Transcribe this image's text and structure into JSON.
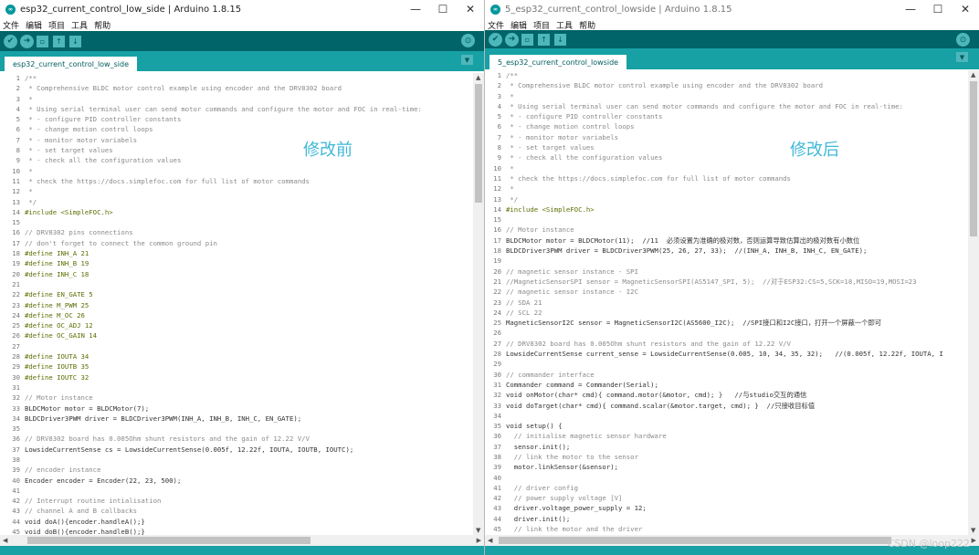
{
  "left": {
    "title": "esp32_current_control_low_side | Arduino 1.8.15",
    "menu": [
      "文件",
      "编辑",
      "项目",
      "工具",
      "帮助"
    ],
    "tab": "esp32_current_control_low_side",
    "annotation": "修改前",
    "lines": [
      {
        "n": "1",
        "t": "/**"
      },
      {
        "n": "2",
        "t": " * Comprehensive BLDC motor control example using encoder and the DRV8302 board"
      },
      {
        "n": "3",
        "t": " *"
      },
      {
        "n": "4",
        "t": " * Using serial terminal user can send motor commands and configure the motor and FOC in real-time:"
      },
      {
        "n": "5",
        "t": " * - configure PID controller constants"
      },
      {
        "n": "6",
        "t": " * - change motion control loops"
      },
      {
        "n": "7",
        "t": " * - monitor motor variabels"
      },
      {
        "n": "8",
        "t": " * - set target values"
      },
      {
        "n": "9",
        "t": " * - check all the configuration values"
      },
      {
        "n": "10",
        "t": " *"
      },
      {
        "n": "11",
        "t": " * check the https://docs.simplefoc.com for full list of motor commands"
      },
      {
        "n": "12",
        "t": " *"
      },
      {
        "n": "13",
        "t": " */"
      },
      {
        "n": "14",
        "t": "#include <SimpleFOC.h>"
      },
      {
        "n": "15",
        "t": ""
      },
      {
        "n": "16",
        "t": "// DRV8302 pins connections"
      },
      {
        "n": "17",
        "t": "// don't forget to connect the common ground pin"
      },
      {
        "n": "18",
        "t": "#define INH_A 21"
      },
      {
        "n": "19",
        "t": "#define INH_B 19"
      },
      {
        "n": "20",
        "t": "#define INH_C 18"
      },
      {
        "n": "21",
        "t": ""
      },
      {
        "n": "22",
        "t": "#define EN_GATE 5"
      },
      {
        "n": "23",
        "t": "#define M_PWM 25"
      },
      {
        "n": "24",
        "t": "#define M_OC 26"
      },
      {
        "n": "25",
        "t": "#define OC_ADJ 12"
      },
      {
        "n": "26",
        "t": "#define OC_GAIN 14"
      },
      {
        "n": "27",
        "t": ""
      },
      {
        "n": "28",
        "t": "#define IOUTA 34"
      },
      {
        "n": "29",
        "t": "#define IOUTB 35"
      },
      {
        "n": "30",
        "t": "#define IOUTC 32"
      },
      {
        "n": "31",
        "t": ""
      },
      {
        "n": "32",
        "t": "// Motor instance"
      },
      {
        "n": "33",
        "t": "BLDCMotor motor = BLDCMotor(7);"
      },
      {
        "n": "34",
        "t": "BLDCDriver3PWM driver = BLDCDriver3PWM(INH_A, INH_B, INH_C, EN_GATE);"
      },
      {
        "n": "35",
        "t": ""
      },
      {
        "n": "36",
        "t": "// DRV8302 board has 0.005Ohm shunt resistors and the gain of 12.22 V/V"
      },
      {
        "n": "37",
        "t": "LowsideCurrentSense cs = LowsideCurrentSense(0.005f, 12.22f, IOUTA, IOUTB, IOUTC);"
      },
      {
        "n": "38",
        "t": ""
      },
      {
        "n": "39",
        "t": "// encoder instance"
      },
      {
        "n": "40",
        "t": "Encoder encoder = Encoder(22, 23, 500);"
      },
      {
        "n": "41",
        "t": ""
      },
      {
        "n": "42",
        "t": "// Interrupt routine intialisation"
      },
      {
        "n": "43",
        "t": "// channel A and B callbacks"
      },
      {
        "n": "44",
        "t": "void doA(){encoder.handleA();}"
      },
      {
        "n": "45",
        "t": "void doB(){encoder.handleB();}"
      }
    ]
  },
  "right": {
    "title": "5_esp32_current_control_lowside | Arduino 1.8.15",
    "menu": [
      "文件",
      "编辑",
      "项目",
      "工具",
      "帮助"
    ],
    "tab": "5_esp32_current_control_lowside",
    "annotation": "修改后",
    "lines": [
      {
        "n": "1",
        "t": "/**"
      },
      {
        "n": "2",
        "t": " * Comprehensive BLDC motor control example using encoder and the DRV8302 board"
      },
      {
        "n": "3",
        "t": " *"
      },
      {
        "n": "4",
        "t": " * Using serial terminal user can send motor commands and configure the motor and FOC in real-time:"
      },
      {
        "n": "5",
        "t": " * - configure PID controller constants"
      },
      {
        "n": "6",
        "t": " * - change motion control loops"
      },
      {
        "n": "7",
        "t": " * - monitor motor variabels"
      },
      {
        "n": "8",
        "t": " * - set target values"
      },
      {
        "n": "9",
        "t": " * - check all the configuration values"
      },
      {
        "n": "10",
        "t": " *"
      },
      {
        "n": "11",
        "t": " * check the https://docs.simplefoc.com for full list of motor commands"
      },
      {
        "n": "12",
        "t": " *"
      },
      {
        "n": "13",
        "t": " */"
      },
      {
        "n": "14",
        "t": "#include <SimpleFOC.h>"
      },
      {
        "n": "15",
        "t": ""
      },
      {
        "n": "16",
        "t": "// Motor instance"
      },
      {
        "n": "17",
        "t": "BLDCMotor motor = BLDCMotor(11);  //11  必须设置为准确的极对数，否则运算导致估算出的极对数有小数位"
      },
      {
        "n": "18",
        "t": "BLDCDriver3PWM driver = BLDCDriver3PWM(25, 26, 27, 33);  //(INH_A, INH_B, INH_C, EN_GATE);"
      },
      {
        "n": "19",
        "t": ""
      },
      {
        "n": "20",
        "t": "// magnetic sensor instance - SPI"
      },
      {
        "n": "21",
        "t": "//MagneticSensorSPI sensor = MagneticSensorSPI(AS5147_SPI, 5);  //对于ESP32:CS=5,SCK=18,MISO=19,MOSI=23"
      },
      {
        "n": "22",
        "t": "// magnetic sensor instance - I2C"
      },
      {
        "n": "23",
        "t": "// SDA 21"
      },
      {
        "n": "24",
        "t": "// SCL 22"
      },
      {
        "n": "25",
        "t": "MagneticSensorI2C sensor = MagneticSensorI2C(AS5600_I2C);  //SPI接口和I2C接口，打开一个屏蔽一个即可"
      },
      {
        "n": "26",
        "t": ""
      },
      {
        "n": "27",
        "t": "// DRV8302 board has 0.005Ohm shunt resistors and the gain of 12.22 V/V"
      },
      {
        "n": "28",
        "t": "LowsideCurrentSense current_sense = LowsideCurrentSense(0.005, 10, 34, 35, 32);   //(0.005f, 12.22f, IOUTA, I"
      },
      {
        "n": "29",
        "t": ""
      },
      {
        "n": "30",
        "t": "// commander interface"
      },
      {
        "n": "31",
        "t": "Commander command = Commander(Serial);"
      },
      {
        "n": "32",
        "t": "void onMotor(char* cmd){ command.motor(&motor, cmd); }   //与studio交互的通信"
      },
      {
        "n": "33",
        "t": "void doTarget(char* cmd){ command.scalar(&motor.target, cmd); }  //只接收目标值"
      },
      {
        "n": "34",
        "t": ""
      },
      {
        "n": "35",
        "t": "void setup() {"
      },
      {
        "n": "36",
        "t": "  // initialise magnetic sensor hardware"
      },
      {
        "n": "37",
        "t": "  sensor.init();"
      },
      {
        "n": "38",
        "t": "  // link the motor to the sensor"
      },
      {
        "n": "39",
        "t": "  motor.linkSensor(&sensor);"
      },
      {
        "n": "40",
        "t": ""
      },
      {
        "n": "41",
        "t": "  // driver config"
      },
      {
        "n": "42",
        "t": "  // power supply voltage [V]"
      },
      {
        "n": "43",
        "t": "  driver.voltage_power_supply = 12;"
      },
      {
        "n": "44",
        "t": "  driver.init();"
      },
      {
        "n": "45",
        "t": "  // link the motor and the driver"
      }
    ]
  },
  "watermark": "CSDN @loop222",
  "colors": {
    "toolbar": "#006468",
    "tabbar": "#17a1a5",
    "accent": "#4db7bb",
    "annotation": "#3fb8d8"
  }
}
